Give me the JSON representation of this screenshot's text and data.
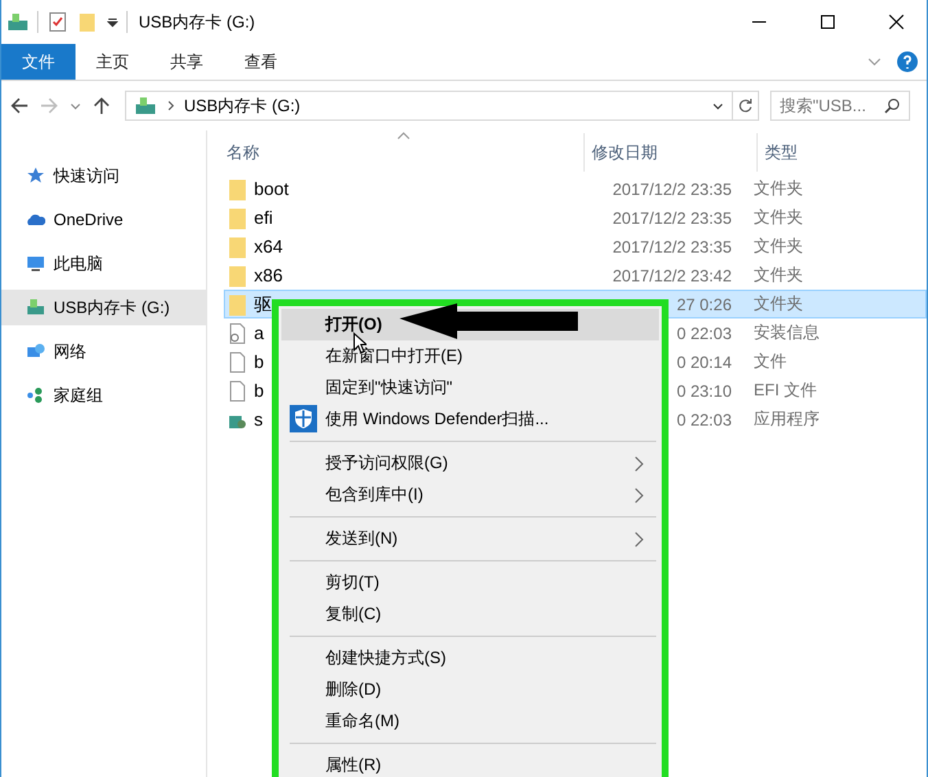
{
  "window": {
    "title": "USB内存卡 (G:)"
  },
  "ribbon_tabs": [
    {
      "label": "文件",
      "selected": true
    },
    {
      "label": "主页",
      "selected": false
    },
    {
      "label": "共享",
      "selected": false
    },
    {
      "label": "查看",
      "selected": false
    }
  ],
  "address_bar": {
    "path": "USB内存卡 (G:)",
    "back_disabled": false,
    "forward_disabled": true
  },
  "search": {
    "placeholder": "搜索\"USB..."
  },
  "sidebar": {
    "items": [
      {
        "label": "快速访问",
        "kind": "star",
        "selected": false
      },
      {
        "label": "OneDrive",
        "kind": "cloud",
        "selected": false
      },
      {
        "label": "此电脑",
        "kind": "pc",
        "selected": false
      },
      {
        "label": "USB内存卡 (G:)",
        "kind": "drive",
        "selected": true
      },
      {
        "label": "网络",
        "kind": "network",
        "selected": false
      },
      {
        "label": "家庭组",
        "kind": "homegroup",
        "selected": false
      }
    ]
  },
  "table": {
    "columns": [
      "名称",
      "修改日期",
      "类型"
    ],
    "rows": [
      {
        "kind": "folder",
        "name": "boot",
        "date": "2017/12/2 23:35",
        "type": "文件夹",
        "selected": false
      },
      {
        "kind": "folder",
        "name": "efi",
        "date": "2017/12/2 23:35",
        "type": "文件夹",
        "selected": false
      },
      {
        "kind": "folder",
        "name": "x64",
        "date": "2017/12/2 23:35",
        "type": "文件夹",
        "selected": false
      },
      {
        "kind": "folder",
        "name": "x86",
        "date": "2017/12/2 23:42",
        "type": "文件夹",
        "selected": false
      },
      {
        "kind": "folder",
        "name": "驱",
        "date": "27 0:26",
        "type": "文件夹",
        "selected": true
      },
      {
        "kind": "setup",
        "name": "a",
        "date": "0 22:03",
        "type": "安装信息",
        "selected": false
      },
      {
        "kind": "file",
        "name": "b",
        "date": "0 20:14",
        "type": "文件",
        "selected": false
      },
      {
        "kind": "file",
        "name": "b",
        "date": "0 23:10",
        "type": "EFI 文件",
        "selected": false
      },
      {
        "kind": "app",
        "name": "s",
        "date": "0 22:03",
        "type": "应用程序",
        "selected": false
      }
    ]
  },
  "context_menu": {
    "items": [
      {
        "kind": "item",
        "label": "打开(O)",
        "bold": true,
        "selected": true,
        "submenu": false
      },
      {
        "kind": "item",
        "label": "在新窗口中打开(E)",
        "bold": false,
        "selected": false,
        "submenu": false
      },
      {
        "kind": "item",
        "label": "固定到\"快速访问\"",
        "bold": false,
        "selected": false,
        "submenu": false
      },
      {
        "kind": "icon-item",
        "label": "使用 Windows Defender扫描...",
        "bold": false,
        "selected": false,
        "submenu": false
      },
      {
        "kind": "separator"
      },
      {
        "kind": "item",
        "label": "授予访问权限(G)",
        "bold": false,
        "selected": false,
        "submenu": true
      },
      {
        "kind": "item",
        "label": "包含到库中(I)",
        "bold": false,
        "selected": false,
        "submenu": true
      },
      {
        "kind": "separator"
      },
      {
        "kind": "item",
        "label": "发送到(N)",
        "bold": false,
        "selected": false,
        "submenu": true
      },
      {
        "kind": "separator"
      },
      {
        "kind": "item",
        "label": "剪切(T)",
        "bold": false,
        "selected": false,
        "submenu": false
      },
      {
        "kind": "item",
        "label": "复制(C)",
        "bold": false,
        "selected": false,
        "submenu": false
      },
      {
        "kind": "separator"
      },
      {
        "kind": "item",
        "label": "创建快捷方式(S)",
        "bold": false,
        "selected": false,
        "submenu": false
      },
      {
        "kind": "item",
        "label": "删除(D)",
        "bold": false,
        "selected": false,
        "submenu": false
      },
      {
        "kind": "item",
        "label": "重命名(M)",
        "bold": false,
        "selected": false,
        "submenu": false
      },
      {
        "kind": "separator"
      },
      {
        "kind": "item",
        "label": "属性(R)",
        "bold": false,
        "selected": false,
        "submenu": false
      }
    ]
  }
}
